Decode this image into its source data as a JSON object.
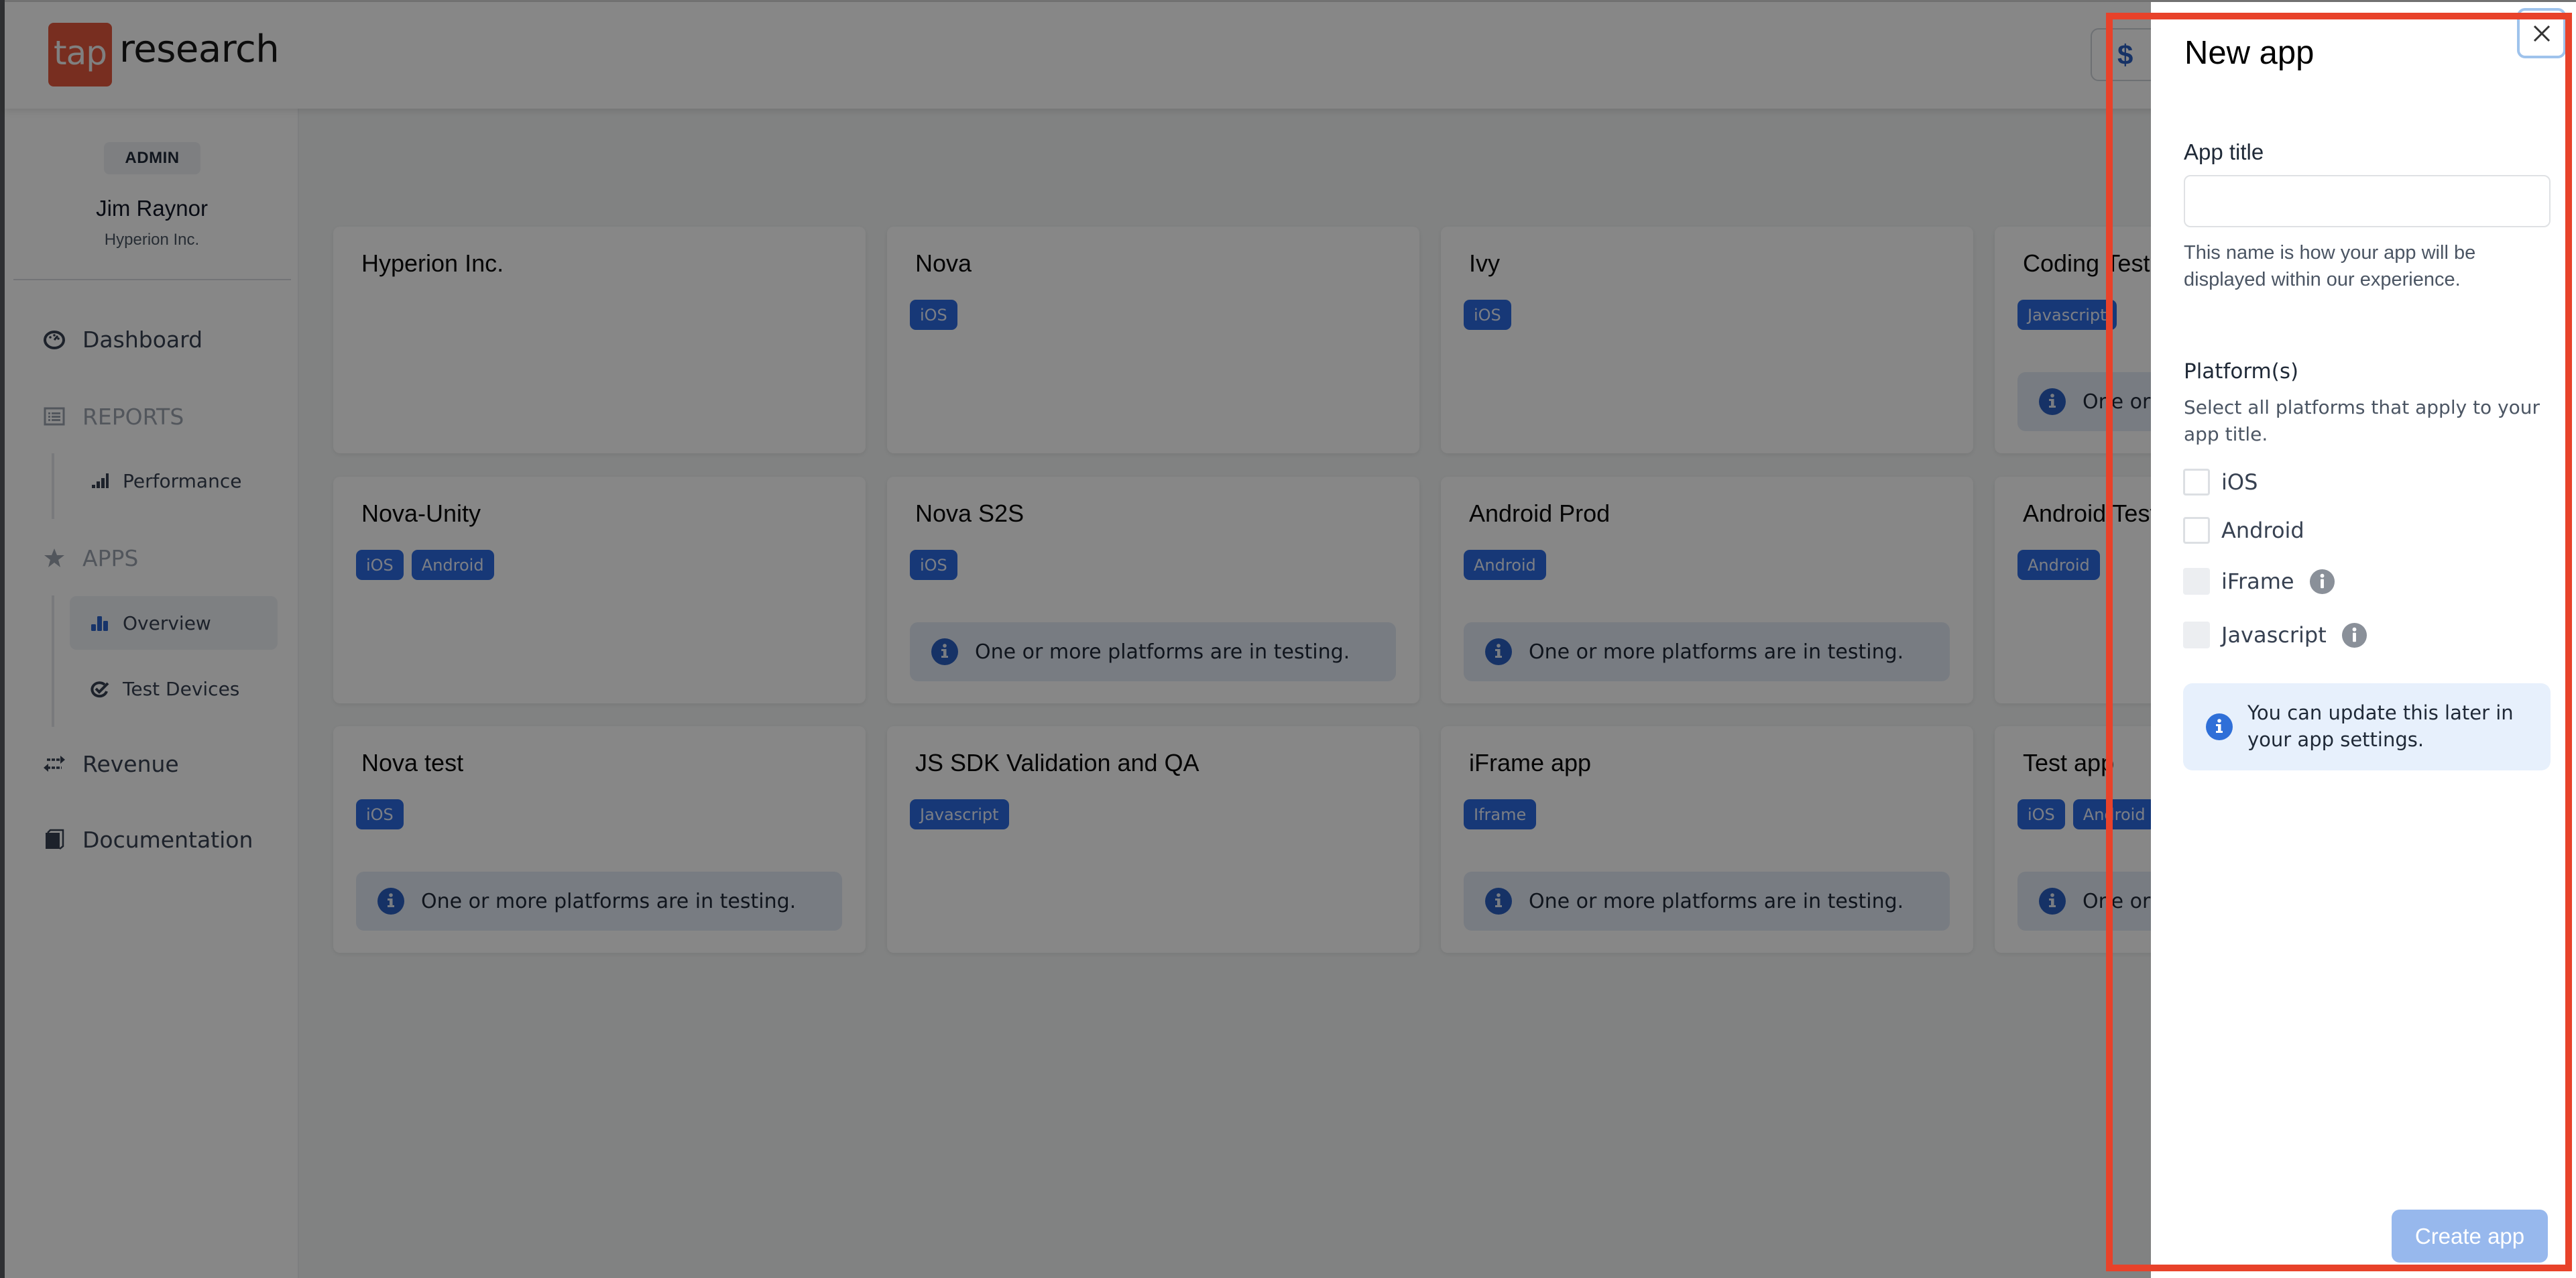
{
  "header": {
    "logo_mark": "tap",
    "logo_text": "research",
    "currency_icon": "$"
  },
  "sidebar": {
    "role_badge": "ADMIN",
    "user_name": "Jim Raynor",
    "user_org": "Hyperion Inc.",
    "items": [
      {
        "label": "Dashboard",
        "icon": "dashboard-gauge-icon"
      },
      {
        "label": "REPORTS",
        "icon": "reports-list-icon",
        "section": true
      },
      {
        "label": "Performance",
        "icon": "signal-bars-icon",
        "sub": true
      },
      {
        "label": "APPS",
        "icon": "star-icon",
        "section": true
      },
      {
        "label": "Overview",
        "icon": "bar-chart-icon",
        "sub": true,
        "active": true
      },
      {
        "label": "Test Devices",
        "icon": "check-device-icon",
        "sub": true
      },
      {
        "label": "Revenue",
        "icon": "transfer-arrows-icon"
      },
      {
        "label": "Documentation",
        "icon": "book-icon"
      }
    ]
  },
  "apps": {
    "testing_notice": "One or more platforms are in testing.",
    "cards": [
      {
        "title": "Hyperion Inc.",
        "platforms": [],
        "in_testing": false
      },
      {
        "title": "Nova",
        "platforms": [
          "iOS"
        ],
        "in_testing": false
      },
      {
        "title": "Ivy",
        "platforms": [
          "iOS"
        ],
        "in_testing": false
      },
      {
        "title": "Coding Test",
        "platforms": [
          "Javascript"
        ],
        "in_testing": true
      },
      {
        "title": "Nova-Unity",
        "platforms": [
          "iOS",
          "Android"
        ],
        "in_testing": false
      },
      {
        "title": "Nova S2S",
        "platforms": [
          "iOS"
        ],
        "in_testing": true
      },
      {
        "title": "Android Prod",
        "platforms": [
          "Android"
        ],
        "in_testing": true
      },
      {
        "title": "Android Test",
        "platforms": [
          "Android"
        ],
        "in_testing": false
      },
      {
        "title": "Nova test",
        "platforms": [
          "iOS"
        ],
        "in_testing": true
      },
      {
        "title": "JS SDK Validation and QA",
        "platforms": [
          "Javascript"
        ],
        "in_testing": false
      },
      {
        "title": "iFrame app",
        "platforms": [
          "Iframe"
        ],
        "in_testing": true
      },
      {
        "title": "Test app",
        "platforms": [
          "iOS",
          "Android"
        ],
        "in_testing": true
      }
    ]
  },
  "panel": {
    "title": "New app",
    "close_label": "Close",
    "app_title_label": "App title",
    "app_title_value": "",
    "app_title_placeholder": "",
    "app_title_help": "This name is how your app will be displayed within our experience.",
    "platforms_label": "Platform(s)",
    "platforms_help": "Select all platforms that apply to your app title.",
    "platform_options": [
      {
        "label": "iOS",
        "checked": false,
        "disabled": false,
        "has_info": false
      },
      {
        "label": "Android",
        "checked": false,
        "disabled": false,
        "has_info": false
      },
      {
        "label": "iFrame",
        "checked": false,
        "disabled": true,
        "has_info": true
      },
      {
        "label": "Javascript",
        "checked": false,
        "disabled": true,
        "has_info": true
      }
    ],
    "update_notice": "You can update this later in your app settings.",
    "create_button": "Create app"
  },
  "colors": {
    "brand": "#e2573d",
    "badge_blue": "#2d6be0",
    "info_blue": "#2f6fd8",
    "create_button_disabled": "#97b8ed",
    "annotation_red": "#e8422a"
  }
}
